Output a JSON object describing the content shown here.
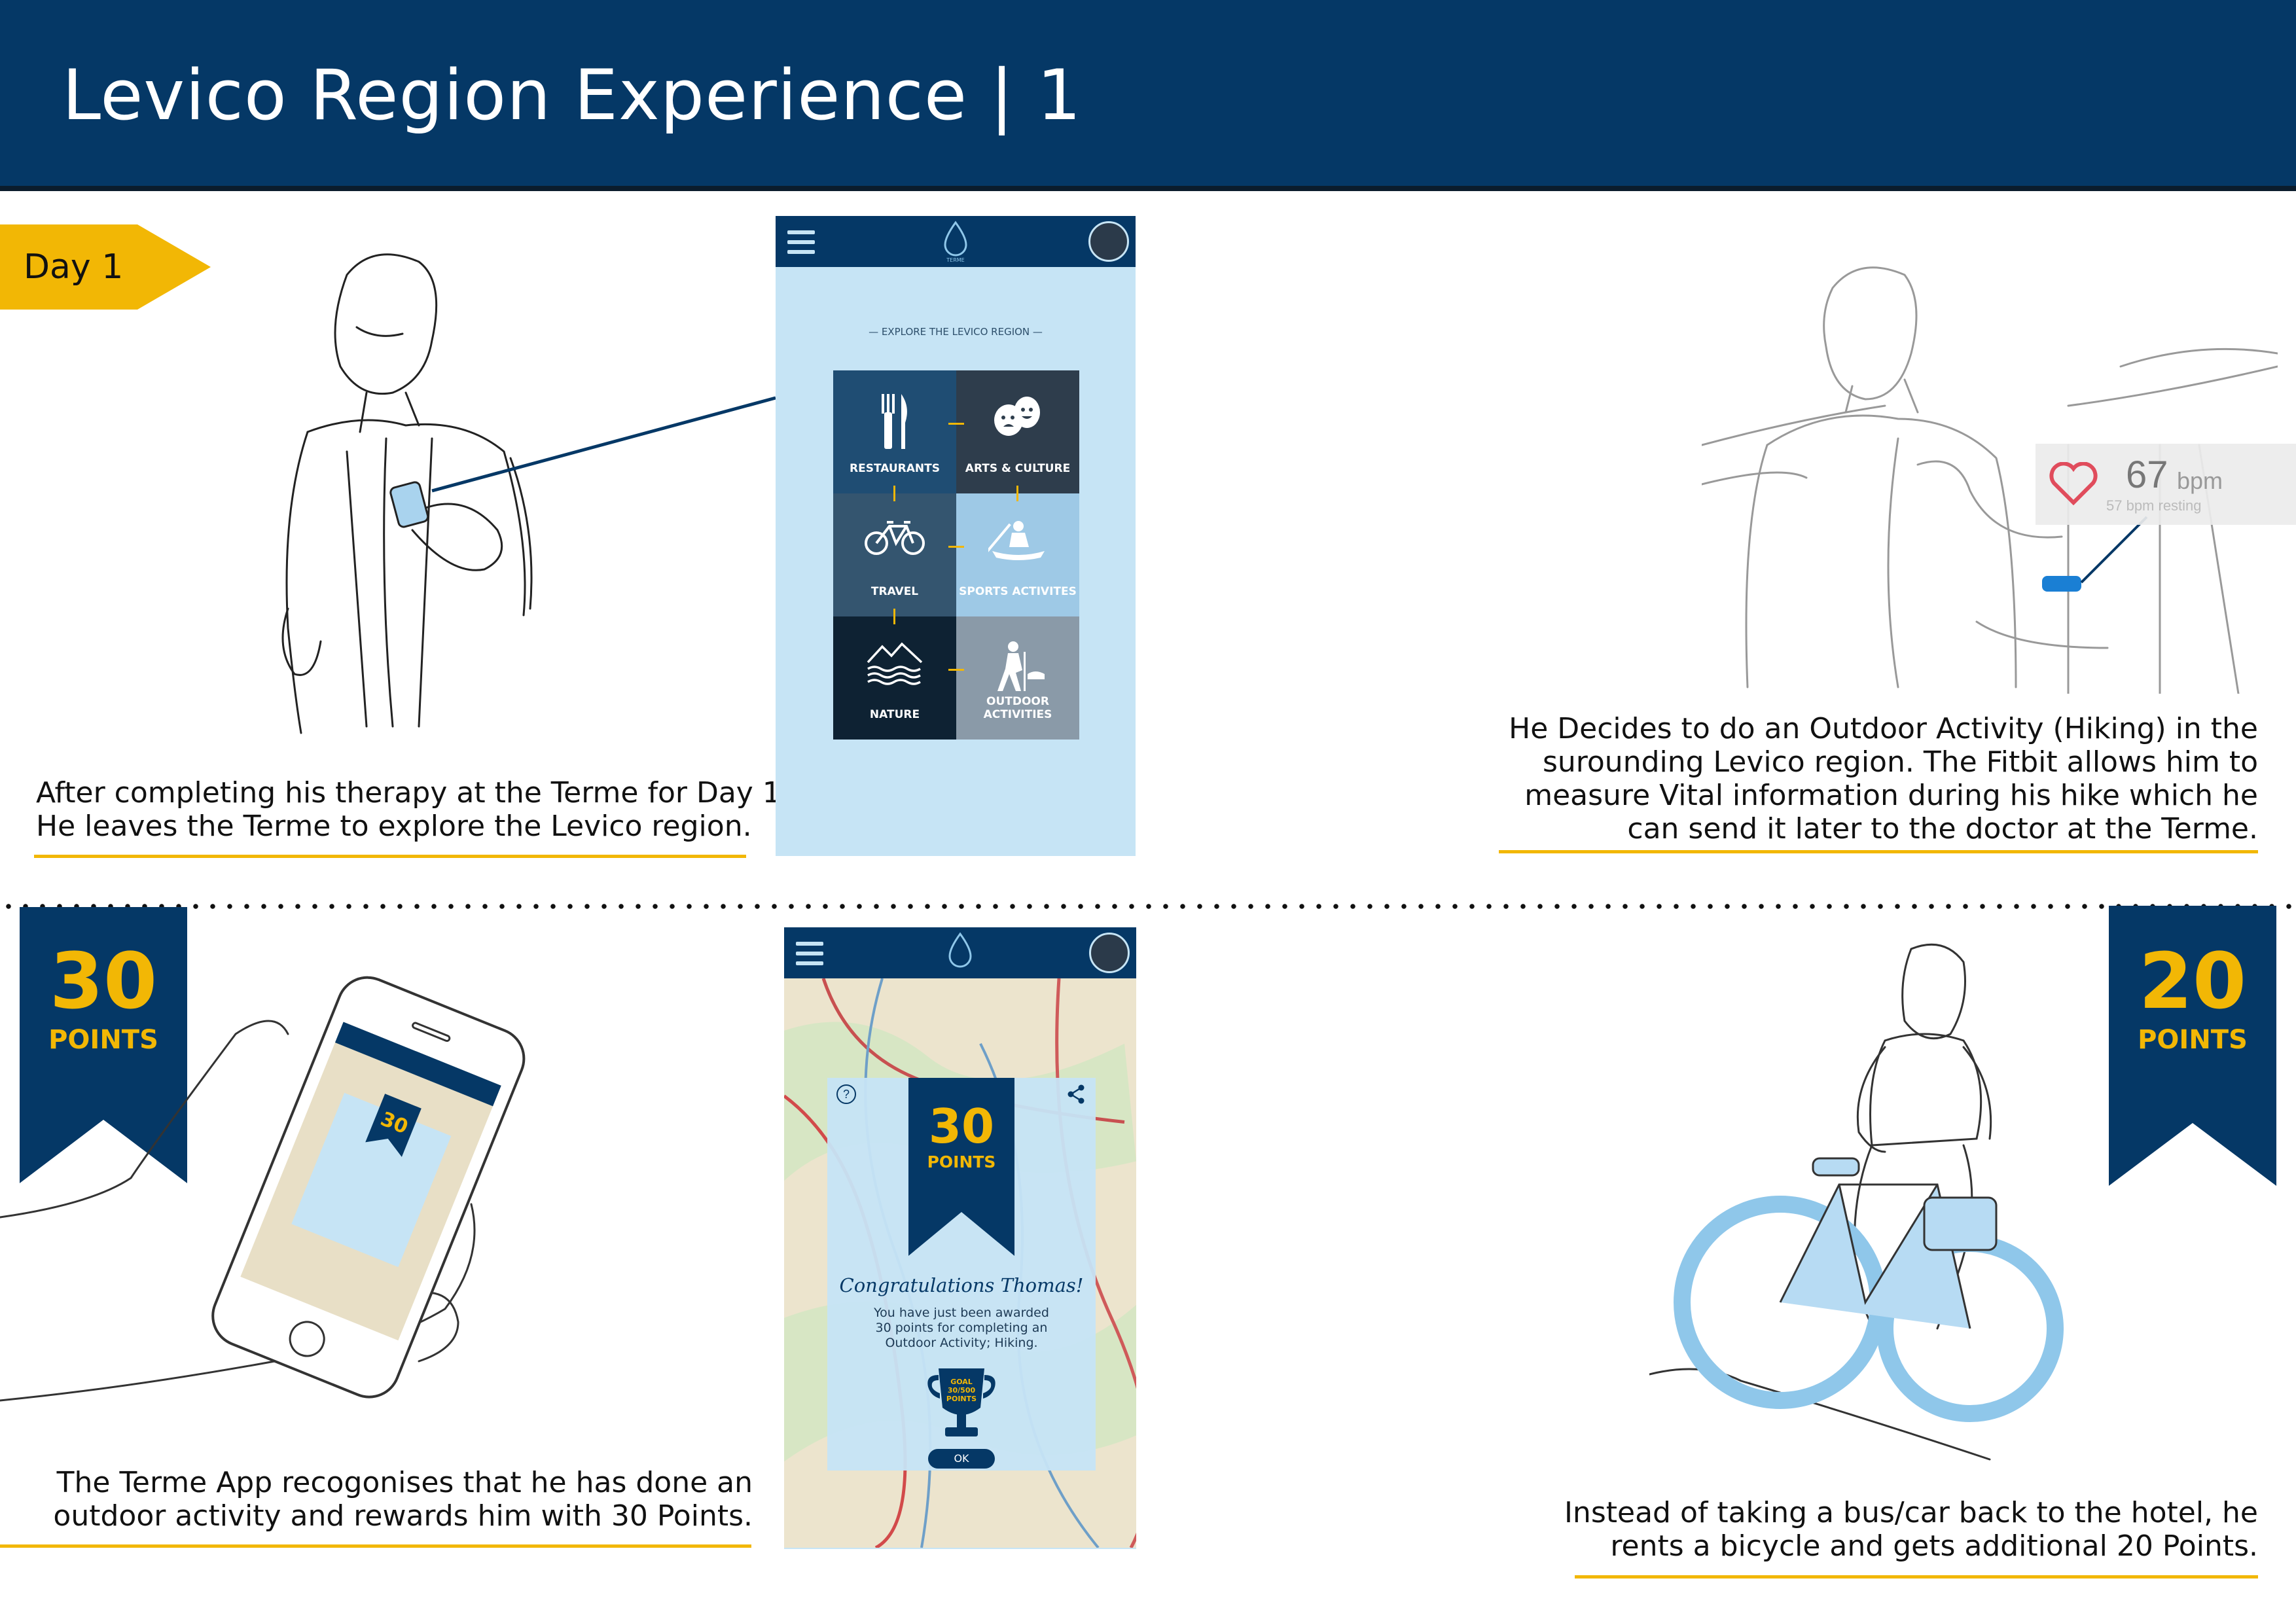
{
  "header": {
    "title": "Levico Region Experience | 1"
  },
  "day_tag": {
    "label": "Day 1"
  },
  "captions": {
    "top_left": [
      "After completing his therapy at the Terme for Day 1",
      "He leaves the Terme to explore the Levico region."
    ],
    "top_right": [
      "He Decides to do an Outdoor Activity (Hiking) in the",
      "surounding Levico region. The Fitbit allows him to",
      "measure Vital information during his hike which he",
      "can send it later to the doctor at the Terme."
    ],
    "bottom_left": [
      "The Terme App recogonises that he has done an",
      "outdoor activity and rewards him with 30 Points."
    ],
    "bottom_right": [
      "Instead of taking a bus/car back to the hotel, he",
      "rents a bicycle and gets additional 20 Points."
    ]
  },
  "explore_screen": {
    "section_title": "— EXPLORE THE LEVICO REGION —",
    "logo_text": "TERME",
    "tiles": [
      {
        "label": "RESTAURANTS",
        "icon": "fork-knife-icon",
        "bg": "#1f4d73"
      },
      {
        "label": "ARTS & CULTURE",
        "icon": "theatre-masks-icon",
        "bg": "#2e3d4c"
      },
      {
        "label": "TRAVEL",
        "icon": "bicycle-icon",
        "bg": "#34556f"
      },
      {
        "label": "SPORTS ACTIVITES",
        "icon": "kayak-icon",
        "bg": "#9ec9e6"
      },
      {
        "label": "NATURE",
        "icon": "mountain-lake-icon",
        "bg": "#0e2233"
      },
      {
        "label": "OUTDOOR ACTIVITIES",
        "icon": "hiker-icon",
        "bg": "#8a9aa8"
      }
    ]
  },
  "fitbit": {
    "bpm_value": "67",
    "bpm_unit": "bpm",
    "resting": "57 bpm resting"
  },
  "reward_screen": {
    "points": "30",
    "points_label": "POINTS",
    "congrats": "Congratulations Thomas!",
    "message": [
      "You have just been awarded",
      "30 points for completing an",
      "Outdoor Activity; Hiking."
    ],
    "goal": [
      "GOAL",
      "30/500",
      "POINTS"
    ],
    "ok": "OK",
    "help_icon": "?"
  },
  "ribbons": {
    "left": {
      "points": "30",
      "label": "POINTS"
    },
    "right": {
      "points": "20",
      "label": "POINTS"
    }
  },
  "colors": {
    "navy": "#053866",
    "accent": "#f2b705",
    "light_blue": "#c6e4f5"
  }
}
